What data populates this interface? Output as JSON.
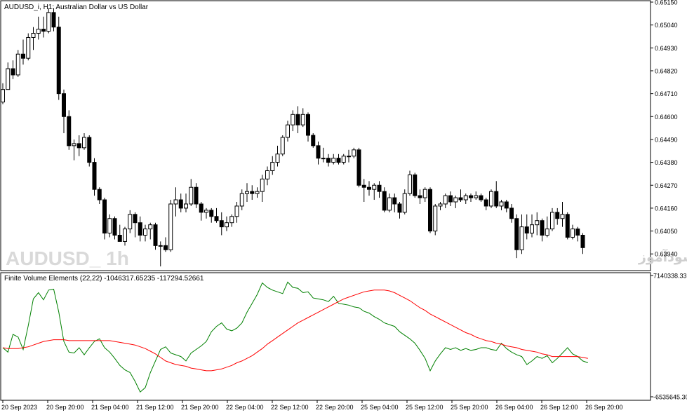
{
  "window": {
    "title": "AUDUSD_i, H1:  Australian Dollar vs US Dollar",
    "watermark_symbol": "AUDUSD_  1h",
    "watermark_site": "انتشار در سایت سودآموز"
  },
  "chart_data": [
    {
      "type": "candlestick",
      "title": "AUDUSD_i, H1:  Australian Dollar vs US Dollar",
      "price_ticks": [
        "0.65150",
        "0.65040",
        "0.64930",
        "0.64820",
        "0.64710",
        "0.64600",
        "0.64490",
        "0.64380",
        "0.64270",
        "0.64160",
        "0.64050",
        "0.63940"
      ],
      "ylim": [
        0.6387,
        0.6515
      ],
      "colors": {
        "up": "#ffffff",
        "down": "#000000",
        "outline": "#000000"
      },
      "candles": [
        [
          0.6467,
          0.6476,
          0.6466,
          0.6473
        ],
        [
          0.6473,
          0.6486,
          0.6473,
          0.6483
        ],
        [
          0.6483,
          0.6487,
          0.6478,
          0.648
        ],
        [
          0.648,
          0.6492,
          0.6479,
          0.649
        ],
        [
          0.649,
          0.6497,
          0.6485,
          0.6488
        ],
        [
          0.6488,
          0.65,
          0.6487,
          0.6498
        ],
        [
          0.6498,
          0.6503,
          0.6492,
          0.65
        ],
        [
          0.65,
          0.6508,
          0.6497,
          0.6502
        ],
        [
          0.6502,
          0.6508,
          0.6498,
          0.6501
        ],
        [
          0.6501,
          0.6512,
          0.65,
          0.651
        ],
        [
          0.651,
          0.6512,
          0.6501,
          0.6503
        ],
        [
          0.6503,
          0.6508,
          0.6468,
          0.6471
        ],
        [
          0.6471,
          0.6473,
          0.6452,
          0.646
        ],
        [
          0.646,
          0.6463,
          0.6444,
          0.6446
        ],
        [
          0.6446,
          0.6449,
          0.6439,
          0.6447
        ],
        [
          0.6447,
          0.6451,
          0.6441,
          0.6445
        ],
        [
          0.6445,
          0.6452,
          0.6444,
          0.645
        ],
        [
          0.645,
          0.6451,
          0.6436,
          0.6438
        ],
        [
          0.6438,
          0.644,
          0.6422,
          0.6425
        ],
        [
          0.6425,
          0.6426,
          0.6418,
          0.642
        ],
        [
          0.642,
          0.6421,
          0.6401,
          0.6404
        ],
        [
          0.6404,
          0.6413,
          0.6402,
          0.6411
        ],
        [
          0.6411,
          0.6412,
          0.6401,
          0.6403
        ],
        [
          0.6403,
          0.6408,
          0.64,
          0.64
        ],
        [
          0.64,
          0.6407,
          0.6398,
          0.6406
        ],
        [
          0.6406,
          0.6415,
          0.6404,
          0.6413
        ],
        [
          0.6413,
          0.6414,
          0.6402,
          0.6409
        ],
        [
          0.6409,
          0.6412,
          0.64,
          0.6403
        ],
        [
          0.6403,
          0.6408,
          0.64,
          0.6406
        ],
        [
          0.6406,
          0.6409,
          0.6401,
          0.6408
        ],
        [
          0.6408,
          0.6409,
          0.6396,
          0.6398
        ],
        [
          0.6398,
          0.64,
          0.6388,
          0.6398
        ],
        [
          0.6398,
          0.6402,
          0.6395,
          0.6396
        ],
        [
          0.6396,
          0.642,
          0.6395,
          0.6418
        ],
        [
          0.6418,
          0.6426,
          0.6412,
          0.642
        ],
        [
          0.642,
          0.6423,
          0.6414,
          0.6416
        ],
        [
          0.6416,
          0.6423,
          0.6414,
          0.6418
        ],
        [
          0.6418,
          0.643,
          0.6417,
          0.6426
        ],
        [
          0.6426,
          0.6428,
          0.6416,
          0.6418
        ],
        [
          0.6418,
          0.6419,
          0.641,
          0.6414
        ],
        [
          0.6414,
          0.6416,
          0.6411,
          0.6415
        ],
        [
          0.6415,
          0.6416,
          0.6409,
          0.6412
        ],
        [
          0.6412,
          0.6416,
          0.6409,
          0.641
        ],
        [
          0.641,
          0.6414,
          0.6403,
          0.6407
        ],
        [
          0.6407,
          0.6412,
          0.6405,
          0.6409
        ],
        [
          0.6409,
          0.6413,
          0.6407,
          0.6412
        ],
        [
          0.6412,
          0.6419,
          0.6409,
          0.6417
        ],
        [
          0.6417,
          0.6425,
          0.6415,
          0.6423
        ],
        [
          0.6423,
          0.6428,
          0.6419,
          0.6424
        ],
        [
          0.6424,
          0.6427,
          0.642,
          0.6423
        ],
        [
          0.6423,
          0.6426,
          0.6421,
          0.6424
        ],
        [
          0.6424,
          0.6432,
          0.6419,
          0.643
        ],
        [
          0.643,
          0.6436,
          0.6427,
          0.6434
        ],
        [
          0.6434,
          0.6441,
          0.6432,
          0.6438
        ],
        [
          0.6438,
          0.6446,
          0.6436,
          0.6442
        ],
        [
          0.6442,
          0.6451,
          0.6441,
          0.645
        ],
        [
          0.645,
          0.6458,
          0.6448,
          0.6456
        ],
        [
          0.6456,
          0.6463,
          0.6453,
          0.6461
        ],
        [
          0.6461,
          0.6465,
          0.6452,
          0.6456
        ],
        [
          0.6456,
          0.6464,
          0.6455,
          0.6461
        ],
        [
          0.6461,
          0.6462,
          0.6448,
          0.6451
        ],
        [
          0.6451,
          0.6452,
          0.6445,
          0.6446
        ],
        [
          0.6446,
          0.6448,
          0.6437,
          0.644
        ],
        [
          0.644,
          0.6445,
          0.6438,
          0.644
        ],
        [
          0.644,
          0.6442,
          0.6436,
          0.6438
        ],
        [
          0.6438,
          0.6442,
          0.6437,
          0.644
        ],
        [
          0.644,
          0.6442,
          0.6437,
          0.6438
        ],
        [
          0.6438,
          0.6442,
          0.6437,
          0.6441
        ],
        [
          0.6441,
          0.6444,
          0.6438,
          0.6441
        ],
        [
          0.6441,
          0.6445,
          0.644,
          0.6444
        ],
        [
          0.6444,
          0.6445,
          0.6426,
          0.6427
        ],
        [
          0.6427,
          0.643,
          0.6419,
          0.6426
        ],
        [
          0.6426,
          0.6429,
          0.6422,
          0.6425
        ],
        [
          0.6425,
          0.6428,
          0.642,
          0.6427
        ],
        [
          0.6427,
          0.6429,
          0.6421,
          0.6424
        ],
        [
          0.6424,
          0.6426,
          0.6414,
          0.6415
        ],
        [
          0.6415,
          0.6423,
          0.6414,
          0.6421
        ],
        [
          0.6421,
          0.6423,
          0.6414,
          0.6418
        ],
        [
          0.6418,
          0.6419,
          0.6411,
          0.6414
        ],
        [
          0.6414,
          0.6425,
          0.6413,
          0.6423
        ],
        [
          0.6423,
          0.6434,
          0.6422,
          0.6432
        ],
        [
          0.6432,
          0.6433,
          0.6421,
          0.6422
        ],
        [
          0.6422,
          0.6425,
          0.6418,
          0.6421
        ],
        [
          0.6421,
          0.6426,
          0.6419,
          0.6425
        ],
        [
          0.6425,
          0.6426,
          0.6404,
          0.6405
        ],
        [
          0.6405,
          0.6418,
          0.6403,
          0.6417
        ],
        [
          0.6417,
          0.6419,
          0.6415,
          0.6418
        ],
        [
          0.6418,
          0.6423,
          0.6416,
          0.6422
        ],
        [
          0.6422,
          0.6424,
          0.6417,
          0.6419
        ],
        [
          0.6419,
          0.6422,
          0.6416,
          0.6421
        ],
        [
          0.6421,
          0.6425,
          0.6419,
          0.642
        ],
        [
          0.642,
          0.6423,
          0.6418,
          0.6422
        ],
        [
          0.6422,
          0.6423,
          0.6419,
          0.6421
        ],
        [
          0.6421,
          0.6424,
          0.642,
          0.6422
        ],
        [
          0.6422,
          0.6423,
          0.6419,
          0.642
        ],
        [
          0.642,
          0.6421,
          0.6415,
          0.6417
        ],
        [
          0.6417,
          0.6425,
          0.6416,
          0.6424
        ],
        [
          0.6424,
          0.6429,
          0.6416,
          0.6417
        ],
        [
          0.6417,
          0.642,
          0.6415,
          0.6419
        ],
        [
          0.6419,
          0.642,
          0.6414,
          0.6416
        ],
        [
          0.6416,
          0.6418,
          0.6409,
          0.6411
        ],
        [
          0.6411,
          0.6413,
          0.6392,
          0.6396
        ],
        [
          0.6396,
          0.6413,
          0.6394,
          0.6407
        ],
        [
          0.6407,
          0.6413,
          0.6401,
          0.6404
        ],
        [
          0.6404,
          0.6413,
          0.6402,
          0.6408
        ],
        [
          0.6408,
          0.6414,
          0.6403,
          0.641
        ],
        [
          0.641,
          0.6411,
          0.64,
          0.6403
        ],
        [
          0.6403,
          0.6412,
          0.6402,
          0.6406
        ],
        [
          0.6406,
          0.6416,
          0.6405,
          0.6414
        ],
        [
          0.6414,
          0.6416,
          0.6408,
          0.6411
        ],
        [
          0.6411,
          0.6419,
          0.6407,
          0.6413
        ],
        [
          0.6413,
          0.6414,
          0.6401,
          0.6402
        ],
        [
          0.6402,
          0.6408,
          0.6401,
          0.6406
        ],
        [
          0.6406,
          0.6407,
          0.64,
          0.6403
        ],
        [
          0.6403,
          0.6404,
          0.6394,
          0.6397
        ]
      ]
    },
    {
      "type": "line",
      "title": "Finite Volume Elements (22,22) -1046317.65235 -117294.52661",
      "y_ticks": [
        "7140338.33",
        "-6535645.30"
      ],
      "ylim": [
        -6535645.3,
        7140338.33
      ],
      "series": [
        {
          "color": "#008000",
          "values": [
            -1000000,
            -1500000,
            500000,
            200000,
            -1200000,
            1500000,
            4500000,
            5200000,
            4400000,
            5500000,
            5600000,
            3000000,
            -300000,
            -1500000,
            -1600000,
            -1000000,
            -1800000,
            -1000000,
            -300000,
            0,
            -1000000,
            -1500000,
            -2200000,
            -3000000,
            -3500000,
            -3800000,
            -4800000,
            -6000000,
            -5500000,
            -3800000,
            -2500000,
            -1200000,
            -900000,
            -1600000,
            -1800000,
            -2000000,
            -2500000,
            -1600000,
            -1200000,
            -800000,
            -300000,
            800000,
            1400000,
            1800000,
            1100000,
            900000,
            1200000,
            1800000,
            3000000,
            4000000,
            5000000,
            6300000,
            5800000,
            5500000,
            5300000,
            5100000,
            6400000,
            5800000,
            5700000,
            5200000,
            5300000,
            4600000,
            4500000,
            4400000,
            4200000,
            4800000,
            4000000,
            3900000,
            3800000,
            3600000,
            3500000,
            3100000,
            2900000,
            2500000,
            2200000,
            1800000,
            1600000,
            1400000,
            800000,
            400000,
            0,
            -500000,
            -1300000,
            -2200000,
            -3600000,
            -2500000,
            -1700000,
            -1000000,
            -1200000,
            -1000000,
            -1300000,
            -1100000,
            -1300000,
            -1200000,
            -1000000,
            -1000000,
            -1200000,
            -1300000,
            -500000,
            -1100000,
            -1500000,
            -1800000,
            -2000000,
            -2900000,
            -2500000,
            -2000000,
            -2200000,
            -1900000,
            -2700000,
            -2200000,
            -1600000,
            -1000000,
            -1700000,
            -2000000,
            -2500000,
            -2700000
          ]
        },
        {
          "color": "#ff0000",
          "values": [
            -1000000,
            -1100000,
            -1100000,
            -1100000,
            -1000000,
            -900000,
            -700000,
            -500000,
            -300000,
            -200000,
            -100000,
            -100000,
            -100000,
            -200000,
            -200000,
            -200000,
            -200000,
            -200000,
            -200000,
            -200000,
            -200000,
            -200000,
            -300000,
            -400000,
            -500000,
            -600000,
            -700000,
            -900000,
            -1100000,
            -1400000,
            -1700000,
            -2100000,
            -2500000,
            -2700000,
            -2900000,
            -3000000,
            -3100000,
            -3300000,
            -3400000,
            -3500000,
            -3600000,
            -3600000,
            -3500000,
            -3400000,
            -3200000,
            -3000000,
            -2700000,
            -2500000,
            -2200000,
            -1900000,
            -1500000,
            -1100000,
            -600000,
            -200000,
            200000,
            600000,
            1000000,
            1400000,
            1800000,
            2100000,
            2400000,
            2700000,
            3000000,
            3300000,
            3600000,
            3900000,
            4200000,
            4500000,
            4700000,
            4900000,
            5100000,
            5300000,
            5400000,
            5500000,
            5500000,
            5500000,
            5400000,
            5200000,
            4900000,
            4600000,
            4300000,
            3900000,
            3500000,
            3200000,
            2800000,
            2500000,
            2200000,
            1900000,
            1600000,
            1300000,
            1000000,
            700000,
            500000,
            200000,
            0,
            -200000,
            -300000,
            -500000,
            -600000,
            -800000,
            -900000,
            -1000000,
            -1200000,
            -1300000,
            -1400000,
            -1500000,
            -1700000,
            -1800000,
            -2000000,
            -2000000,
            -2000000,
            -2000000,
            -2000000,
            -2000000,
            -2100000,
            -2200000
          ]
        }
      ]
    }
  ],
  "time_axis": {
    "labels": [
      "20 Sep 2023",
      "20 Sep 20:00",
      "21 Sep 04:00",
      "21 Sep 12:00",
      "21 Sep 20:00",
      "22 Sep 04:00",
      "22 Sep 12:00",
      "22 Sep 20:00",
      "25 Sep 04:00",
      "25 Sep 12:00",
      "25 Sep 20:00",
      "26 Sep 04:00",
      "26 Sep 12:00",
      "26 Sep 20:00"
    ]
  }
}
